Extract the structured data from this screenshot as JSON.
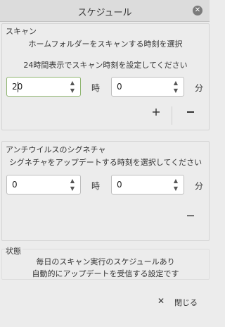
{
  "window": {
    "title": "スケジュール"
  },
  "scan": {
    "heading": "スキャン",
    "description": "ホームフォルダーをスキャンする時刻を選択",
    "hint": "24時間表示でスキャン時刻を設定してください",
    "hour_value": "20",
    "hour_unit": "時",
    "minute_value": "0",
    "minute_unit": "分"
  },
  "update": {
    "heading": "アンチウイルスのシグネチャ",
    "description": "シグネチャをアップデートする時刻を選択してください",
    "hour_value": "0",
    "hour_unit": "時",
    "minute_value": "0",
    "minute_unit": "分"
  },
  "status": {
    "heading": "状態",
    "line1": "毎日のスキャン実行のスケジュールあり",
    "line2": "自動的にアップデートを受信する設定です"
  },
  "footer": {
    "close_label": "閉じる"
  },
  "icons": {
    "close": "close-icon",
    "add": "plus-icon",
    "remove": "minus-icon",
    "up": "arrow-up-icon",
    "down": "arrow-down-icon"
  }
}
